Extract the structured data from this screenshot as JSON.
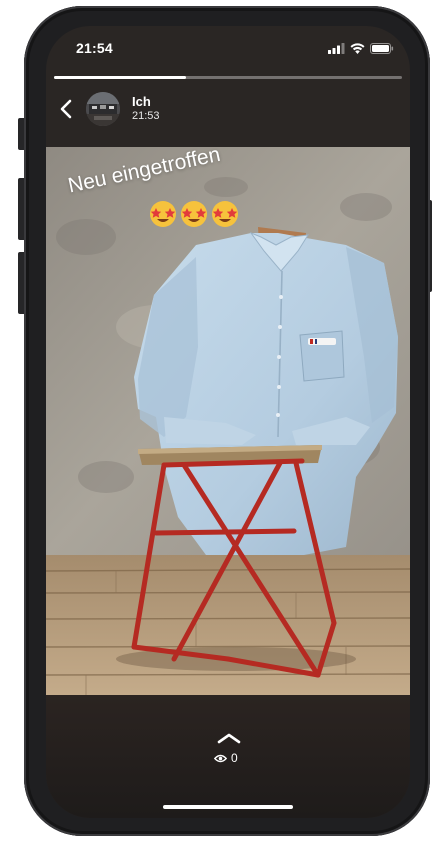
{
  "status_bar": {
    "time": "21:54",
    "icons": [
      "signal-icon",
      "wifi-icon",
      "battery-icon"
    ]
  },
  "story": {
    "progress": 0.38,
    "user_name": "Ich",
    "post_time": "21:53",
    "caption": "Neu eingetroffen",
    "emoji": "🤩🤩🤩",
    "viewer_count": "0"
  },
  "colors": {
    "accent": "#ffffff",
    "chair_red": "#b52a22",
    "shirt_blue": "#bcd3e6",
    "wall": "#a5a095",
    "floor": "#b89f7f"
  }
}
